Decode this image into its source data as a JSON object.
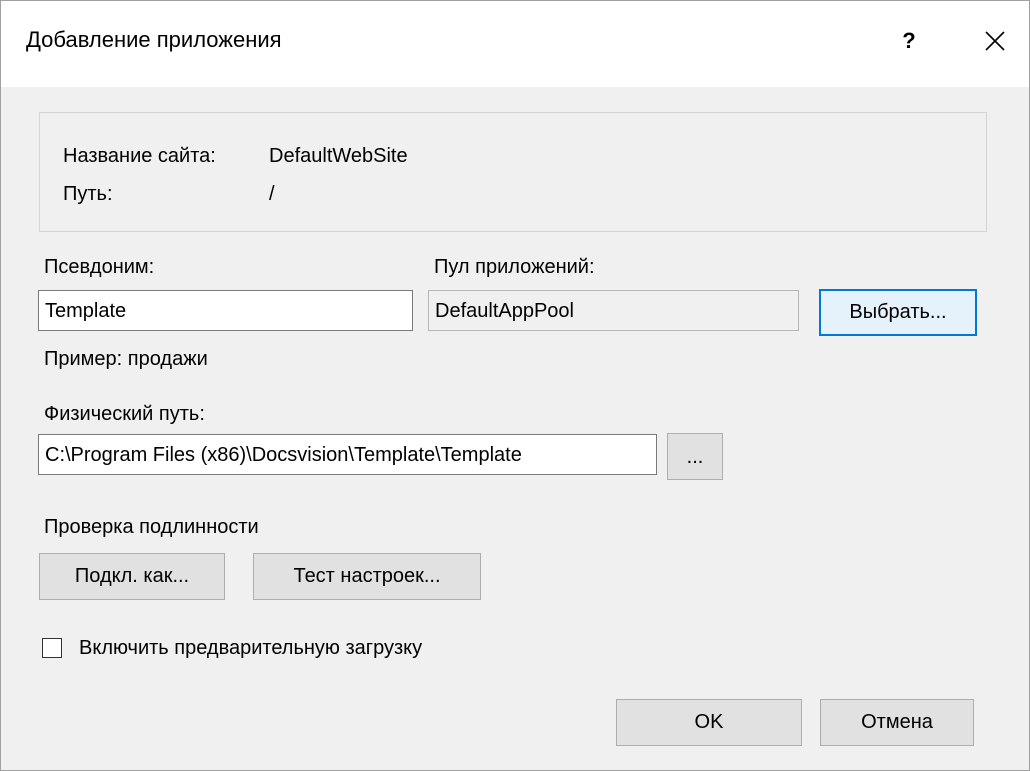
{
  "window": {
    "title": "Добавление приложения",
    "help_label": "?",
    "close_icon": "close-icon"
  },
  "site_info": {
    "site_name_label": "Название сайта:",
    "site_name_value": "DefaultWebSite",
    "path_label": "Путь:",
    "path_value": "/"
  },
  "alias": {
    "label": "Псевдоним:",
    "value": "Template",
    "hint": "Пример: продажи"
  },
  "app_pool": {
    "label": "Пул приложений:",
    "value": "DefaultAppPool",
    "select_button": "Выбрать..."
  },
  "physical_path": {
    "label": "Физический путь:",
    "value": "C:\\Program Files (x86)\\Docsvision\\Template\\Template",
    "browse_button": "..."
  },
  "authentication": {
    "label": "Проверка подлинности",
    "connect_as_button": "Подкл. как...",
    "test_settings_button": "Тест настроек..."
  },
  "preload": {
    "label": "Включить предварительную загрузку",
    "checked": false
  },
  "footer": {
    "ok_button": "OK",
    "cancel_button": "Отмена"
  },
  "colors": {
    "focus_accent": "#0078d7",
    "dialog_bg": "#f0f0f0"
  }
}
